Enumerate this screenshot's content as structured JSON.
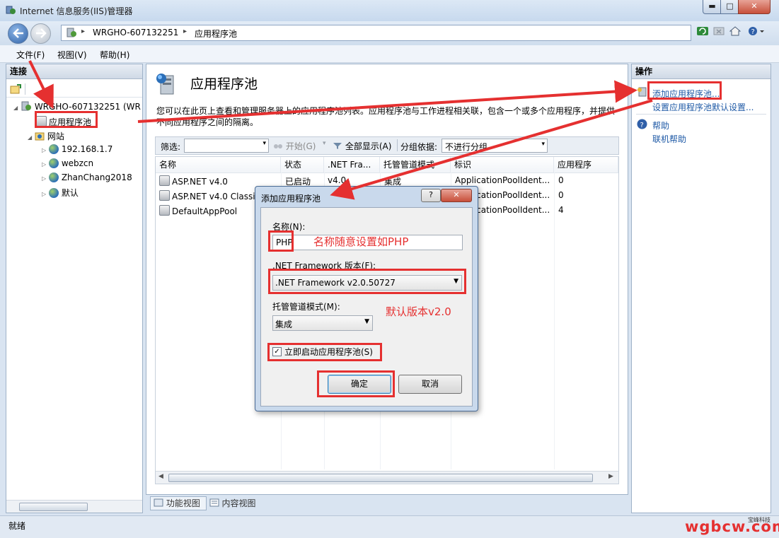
{
  "window": {
    "title": "Internet 信息服务(IIS)管理器",
    "min_glyph": "▬",
    "max_glyph": "□",
    "close_glyph": "✕"
  },
  "address": {
    "crumbs": [
      "WRGHO-607132251",
      "应用程序池"
    ],
    "separator": "▸"
  },
  "menu": [
    "文件(F)",
    "视图(V)",
    "帮助(H)"
  ],
  "connections": {
    "header": "连接",
    "tree": {
      "server": "WRGHO-607132251 (WR",
      "app_pools": "应用程序池",
      "sites": "网站",
      "site_items": [
        "192.168.1.7",
        "webzcn",
        "ZhanChang2018",
        "默认"
      ]
    }
  },
  "main": {
    "title": "应用程序池",
    "description": "您可以在此页上查看和管理服务器上的应用程序池列表。应用程序池与工作进程相关联，包含一个或多个应用程序，并提供不同应用程序之间的隔离。",
    "filter": {
      "label": "筛选:",
      "start": "开始(G)",
      "show_all": "全部显示(A)",
      "group_label": "分组依据:",
      "group_value": "不进行分组"
    },
    "columns": [
      "名称",
      "状态",
      ".NET Fra...",
      "托管管道模式",
      "标识",
      "应用程序"
    ],
    "rows": [
      {
        "name": "ASP.NET v4.0",
        "status": "已启动",
        "net": "v4.0",
        "pipeline": "集成",
        "identity": "ApplicationPoolIdent...",
        "apps": "0"
      },
      {
        "name": "ASP.NET v4.0 Classic",
        "status": "",
        "net": "",
        "pipeline": "",
        "identity": "ApplicationPoolIdent...",
        "apps": "0"
      },
      {
        "name": "DefaultAppPool",
        "status": "",
        "net": "",
        "pipeline": "",
        "identity": "ApplicationPoolIdent...",
        "apps": "4"
      }
    ],
    "view_tabs": [
      "功能视图",
      "内容视图"
    ]
  },
  "actions": {
    "header": "操作",
    "add_pool": "添加应用程序池...",
    "set_defaults": "设置应用程序池默认设置...",
    "help": "帮助",
    "online_help": "联机帮助"
  },
  "dialog": {
    "title": "添加应用程序池",
    "help_glyph": "?",
    "close_glyph": "✕",
    "name_label": "名称(N):",
    "name_value": "PHP",
    "framework_label": ".NET Framework 版本(F):",
    "framework_value": ".NET Framework v2.0.50727",
    "pipeline_label": "托管管道模式(M):",
    "pipeline_value": "集成",
    "autostart_label": "立即启动应用程序池(S)",
    "autostart_checked": true,
    "ok": "确定",
    "cancel": "取消"
  },
  "annotations": {
    "name_hint": "名称随意设置如PHP",
    "version_hint": "默认版本v2.0",
    "accent": "#e53030"
  },
  "status": {
    "text": "就绪",
    "brand_small": "宝峰科技",
    "watermark": "wgbcw.com"
  }
}
